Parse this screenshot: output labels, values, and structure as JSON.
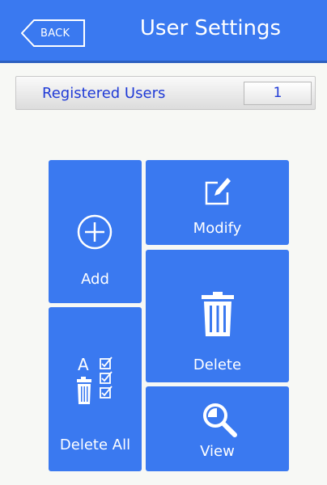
{
  "header": {
    "back_label": "BACK",
    "title": "User Settings"
  },
  "registered_users": {
    "label": "Registered Users",
    "count": "1"
  },
  "tiles": {
    "add": "Add",
    "modify": "Modify",
    "delete": "Delete",
    "delete_all": "Delete All",
    "view": "View"
  },
  "delete_all_icon_letter": "A",
  "colors": {
    "accent": "#3a79f0",
    "count_text": "#1f3ad6",
    "background": "#f7f8f5"
  }
}
